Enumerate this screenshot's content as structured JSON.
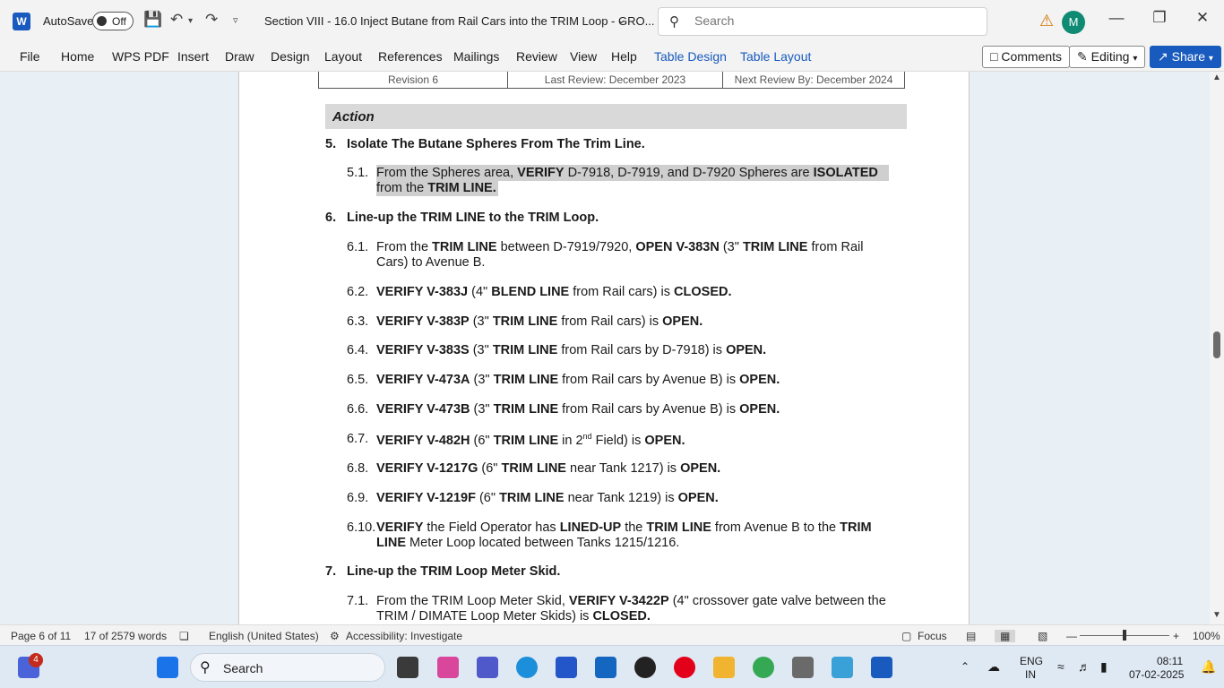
{
  "titlebar": {
    "autosave_label": "AutoSave",
    "autosave_state": "Off",
    "document_title": "Section VIII - 16.0 Inject Butane from Rail Cars into the TRIM Loop - GRO...",
    "search_placeholder": "Search",
    "avatar_initial": "M"
  },
  "ribbon": {
    "tabs": [
      "File",
      "Home",
      "WPS PDF",
      "Insert",
      "Draw",
      "Design",
      "Layout",
      "References",
      "Mailings",
      "Review",
      "View",
      "Help",
      "Table Design",
      "Table Layout"
    ],
    "comments_label": "Comments",
    "editing_label": "Editing",
    "share_label": "Share"
  },
  "document": {
    "revision_row": [
      "Revision 6",
      "Last Review: December 2023",
      "Next Review By: December 2024"
    ],
    "action_heading": "Action",
    "s5_num": "5.",
    "s5_title": "Isolate The Butane Spheres From The Trim Line.",
    "s51_num": "5.1.",
    "s51_a": "From the Spheres area, ",
    "s51_b": "VERIFY",
    "s51_c": " D-7918, D-7919, and D-7920 Spheres are ",
    "s51_d": "ISOLATED",
    "s51_e": "from the ",
    "s51_f": "TRIM LINE.",
    "s6_num": "6.",
    "s6_title": "Line-up the TRIM LINE to the TRIM Loop.",
    "s61_num": "6.1.",
    "s61_a": "From the ",
    "s61_b": "TRIM LINE",
    "s61_c": " between D-7919/7920, ",
    "s61_d": "OPEN V-383N",
    "s61_e": " (3\" ",
    "s61_f": "TRIM LINE",
    "s61_g": " from Rail",
    "s61_h": "Cars) to Avenue B.",
    "s62_num": "6.2.",
    "s62_a": "VERIFY V-383J",
    "s62_b": " (4\" ",
    "s62_c": "BLEND LINE",
    "s62_d": " from Rail cars) is ",
    "s62_e": "CLOSED.",
    "s63_num": "6.3.",
    "s63_a": "VERIFY V-383P",
    "s63_b": " (3\" ",
    "s63_c": "TRIM LINE",
    "s63_d": " from Rail cars) is ",
    "s63_e": "OPEN.",
    "s64_num": "6.4.",
    "s64_a": "VERIFY V-383S",
    "s64_b": " (3\" ",
    "s64_c": "TRIM LINE",
    "s64_d": " from Rail cars by D-7918) is ",
    "s64_e": "OPEN.",
    "s65_num": "6.5.",
    "s65_a": "VERIFY V-473A",
    "s65_b": " (3\" ",
    "s65_c": "TRIM LINE",
    "s65_d": " from Rail cars by Avenue B) is ",
    "s65_e": "OPEN.",
    "s66_num": "6.6.",
    "s66_a": "VERIFY V-473B",
    "s66_b": " (3\" ",
    "s66_c": "TRIM LINE",
    "s66_d": " from Rail cars by Avenue B) is ",
    "s66_e": "OPEN.",
    "s67_num": "6.7.",
    "s67_a": "VERIFY V-482H",
    "s67_b": " (6\" ",
    "s67_c": "TRIM LINE",
    "s67_d": " in 2",
    "s67_sup": "nd",
    "s67_e": " Field) is ",
    "s67_f": "OPEN.",
    "s68_num": "6.8.",
    "s68_a": "VERIFY V-1217G",
    "s68_b": " (6\" ",
    "s68_c": "TRIM LINE",
    "s68_d": " near Tank 1217) is ",
    "s68_e": "OPEN.",
    "s69_num": "6.9.",
    "s69_a": "VERIFY V-1219F",
    "s69_b": " (6\" ",
    "s69_c": "TRIM LINE",
    "s69_d": " near Tank 1219) is ",
    "s69_e": "OPEN.",
    "s610_num": "6.10.",
    "s610_a": "VERIFY",
    "s610_b": " the Field Operator has ",
    "s610_c": "LINED-UP",
    "s610_d": " the ",
    "s610_e": "TRIM LINE",
    "s610_f": " from Avenue B to the ",
    "s610_g": "TRIM",
    "s610_h": "LINE",
    "s610_i": " Meter Loop located between Tanks 1215/1216.",
    "s7_num": "7.",
    "s7_title": "Line-up the TRIM Loop Meter Skid.",
    "s71_num": "7.1.",
    "s71_a": "From the TRIM Loop Meter Skid, ",
    "s71_b": "VERIFY V-3422P",
    "s71_c": " (4\" crossover gate valve between the",
    "s71_d": "TRIM / DIMATE Loop Meter Skids) is ",
    "s71_e": "CLOSED."
  },
  "statusbar": {
    "page": "Page 6 of 11",
    "words": "17 of 2579 words",
    "language": "English (United States)",
    "accessibility": "Accessibility: Investigate",
    "focus": "Focus",
    "zoom": "100%",
    "zoom_fraction": 0.5
  },
  "taskbar": {
    "search_label": "Search",
    "badge_count": "4",
    "lang_line1": "ENG",
    "lang_line2": "IN",
    "time": "08:11",
    "date": "07-02-2025"
  },
  "colors": {
    "accent": "#185abd",
    "avatar": "#0f8a73",
    "selection": "#cfcfcf",
    "action_band": "#d9d9d9"
  }
}
